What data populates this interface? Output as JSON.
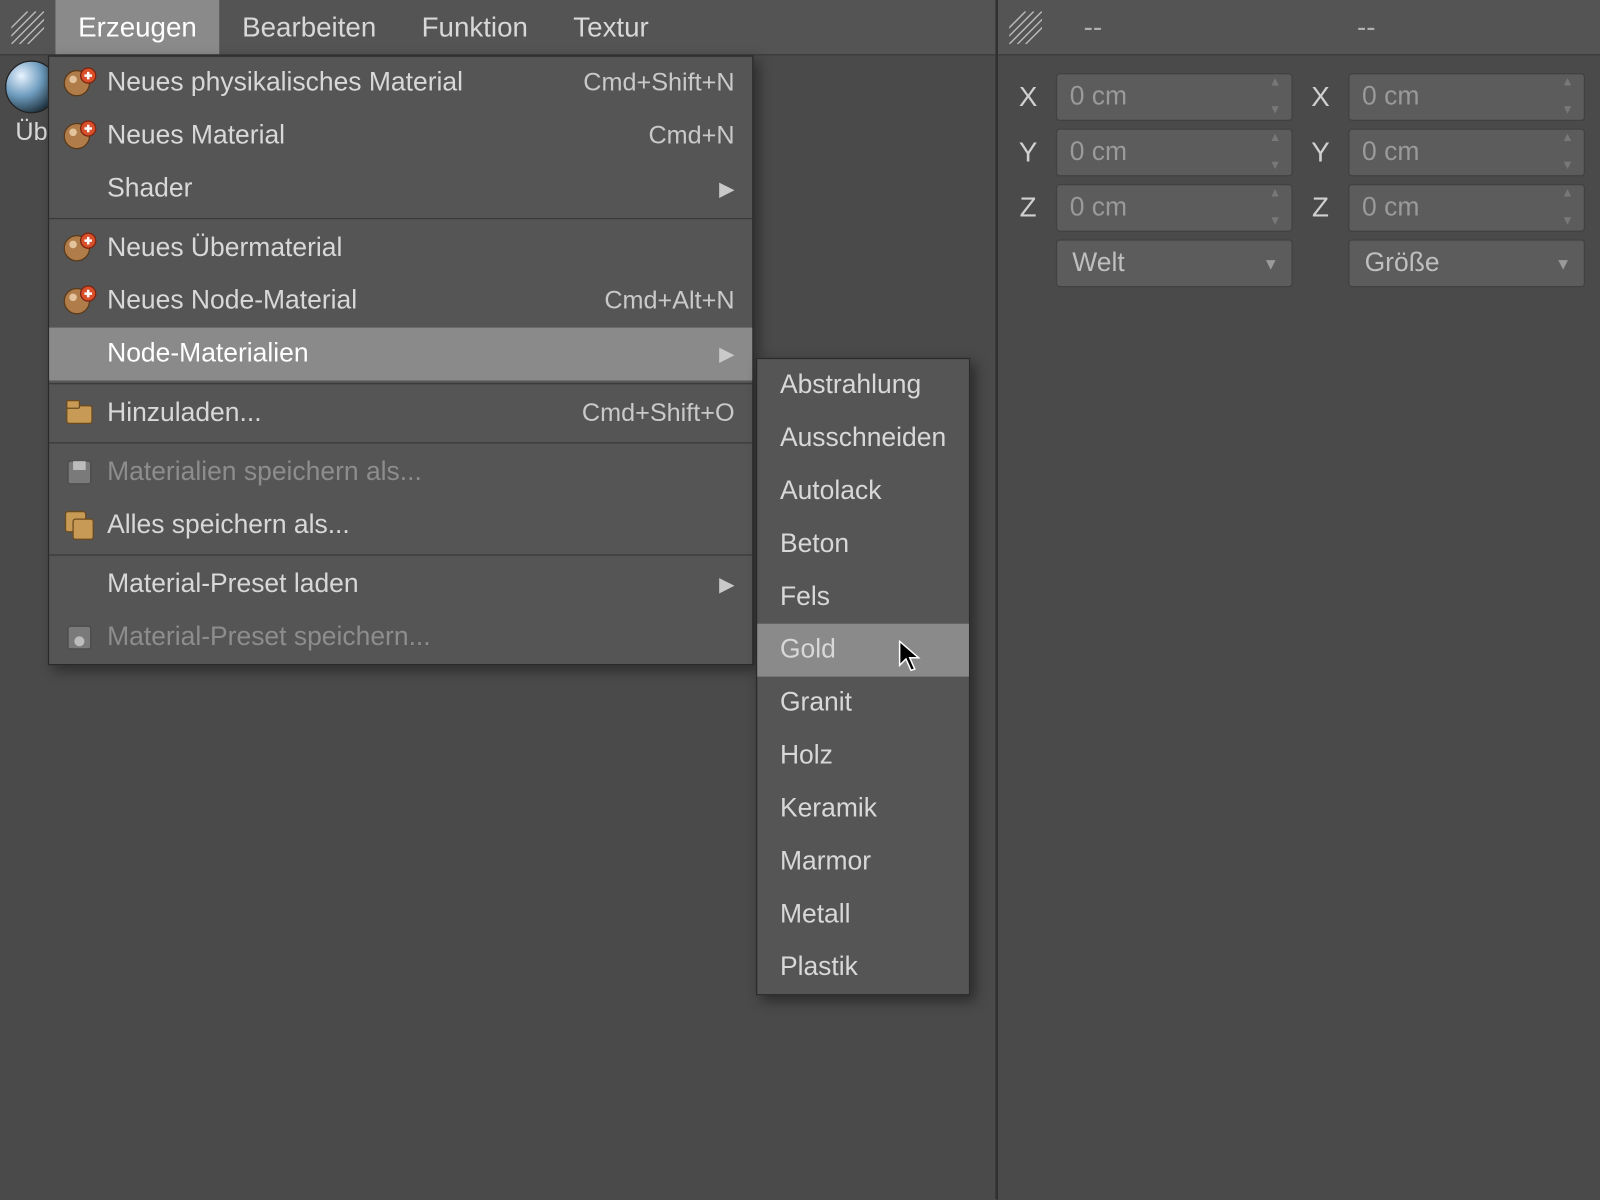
{
  "menubar_left": {
    "items": [
      "Erzeugen",
      "Bearbeiten",
      "Funktion",
      "Textur"
    ],
    "active_index": 0
  },
  "menubar_right": {
    "dash1": "--",
    "dash2": "--"
  },
  "material_thumb": {
    "label": "Üb"
  },
  "main_menu": {
    "groups": [
      [
        {
          "icon": "new-material-icon",
          "label": "Neues physikalisches Material",
          "shortcut": "Cmd+Shift+N"
        },
        {
          "icon": "new-material-icon",
          "label": "Neues Material",
          "shortcut": "Cmd+N"
        },
        {
          "icon": "",
          "label": "Shader",
          "submenu": true
        }
      ],
      [
        {
          "icon": "new-material-icon",
          "label": "Neues Übermaterial"
        },
        {
          "icon": "new-material-icon",
          "label": "Neues Node-Material",
          "shortcut": "Cmd+Alt+N"
        },
        {
          "icon": "",
          "label": "Node-Materialien",
          "submenu": true,
          "highlight": true
        }
      ],
      [
        {
          "icon": "load-icon",
          "label": "Hinzuladen...",
          "shortcut": "Cmd+Shift+O"
        }
      ],
      [
        {
          "icon": "save-icon",
          "label": "Materialien speichern als...",
          "disabled": true
        },
        {
          "icon": "save-all-icon",
          "label": "Alles speichern als..."
        }
      ],
      [
        {
          "icon": "",
          "label": "Material-Preset laden",
          "submenu": true
        },
        {
          "icon": "preset-save-icon",
          "label": "Material-Preset speichern...",
          "disabled": true
        }
      ]
    ]
  },
  "submenu": {
    "items": [
      "Abstrahlung",
      "Ausschneiden",
      "Autolack",
      "Beton",
      "Fels",
      "Gold",
      "Granit",
      "Holz",
      "Keramik",
      "Marmor",
      "Metall",
      "Plastik"
    ],
    "highlight_index": 5
  },
  "coords": {
    "rows": [
      {
        "axis": "X",
        "val1": "0 cm",
        "axis2": "X",
        "val2": "0 cm"
      },
      {
        "axis": "Y",
        "val1": "0 cm",
        "axis2": "Y",
        "val2": "0 cm"
      },
      {
        "axis": "Z",
        "val1": "0 cm",
        "axis2": "Z",
        "val2": "0 cm"
      }
    ],
    "dropdown1": "Welt",
    "dropdown2": "Größe"
  }
}
